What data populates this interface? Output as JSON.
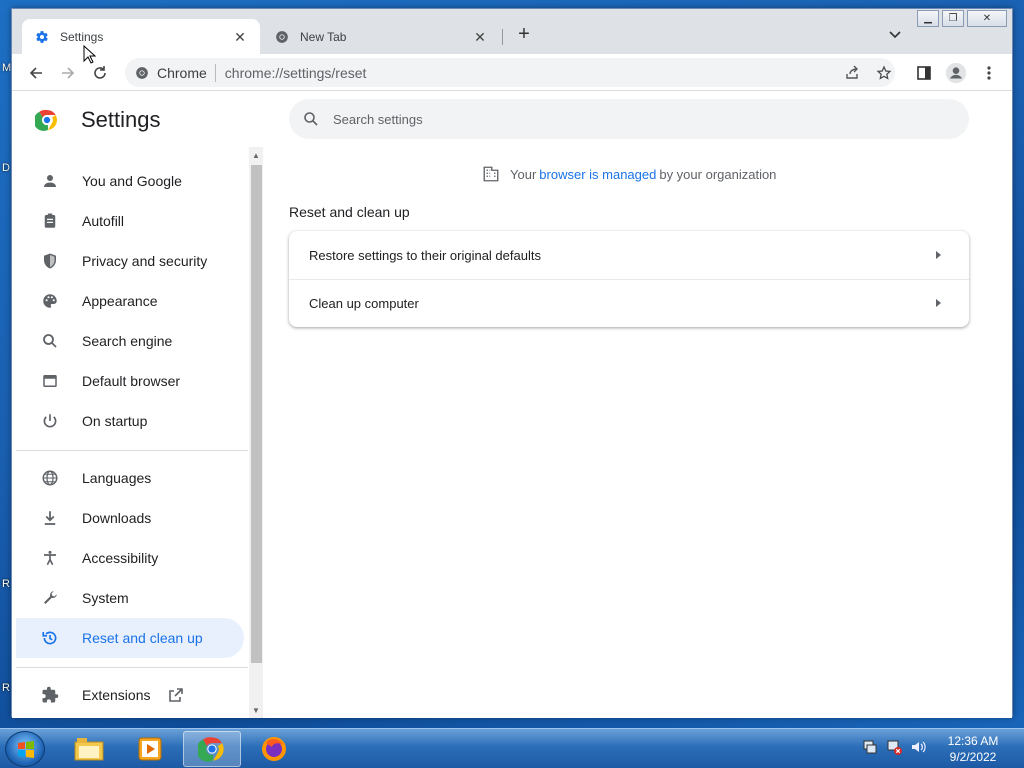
{
  "tabs": [
    {
      "title": "Settings",
      "favicon": "gear-icon",
      "active": true
    },
    {
      "title": "New Tab",
      "favicon": "chrome-icon",
      "active": false
    }
  ],
  "toolbar": {
    "chip_label": "Chrome",
    "url": "chrome://settings/reset"
  },
  "settings": {
    "title": "Settings",
    "search_placeholder": "Search settings"
  },
  "sidebar": {
    "items": [
      {
        "label": "You and Google",
        "icon": "person-icon"
      },
      {
        "label": "Autofill",
        "icon": "clipboard-icon"
      },
      {
        "label": "Privacy and security",
        "icon": "shield-icon"
      },
      {
        "label": "Appearance",
        "icon": "palette-icon"
      },
      {
        "label": "Search engine",
        "icon": "search-icon"
      },
      {
        "label": "Default browser",
        "icon": "browser-icon"
      },
      {
        "label": "On startup",
        "icon": "power-icon"
      },
      {
        "label": "Languages",
        "icon": "globe-icon"
      },
      {
        "label": "Downloads",
        "icon": "download-icon"
      },
      {
        "label": "Accessibility",
        "icon": "accessibility-icon"
      },
      {
        "label": "System",
        "icon": "wrench-icon"
      },
      {
        "label": "Reset and clean up",
        "icon": "history-icon",
        "selected": true
      },
      {
        "label": "Extensions",
        "icon": "puzzle-icon"
      }
    ]
  },
  "main": {
    "managed_prefix": "Your",
    "managed_link": "browser is managed",
    "managed_suffix": "by your organization",
    "section_title": "Reset and clean up",
    "rows": [
      {
        "label": "Restore settings to their original defaults"
      },
      {
        "label": "Clean up computer"
      }
    ]
  },
  "taskbar": {
    "time": "12:36 AM",
    "date": "9/2/2022",
    "apps": [
      "explorer-icon",
      "media-player-icon",
      "chrome-icon",
      "firefox-icon"
    ]
  },
  "colors": {
    "accent": "#1a73e8",
    "selected_bg": "#e8f0fe"
  }
}
